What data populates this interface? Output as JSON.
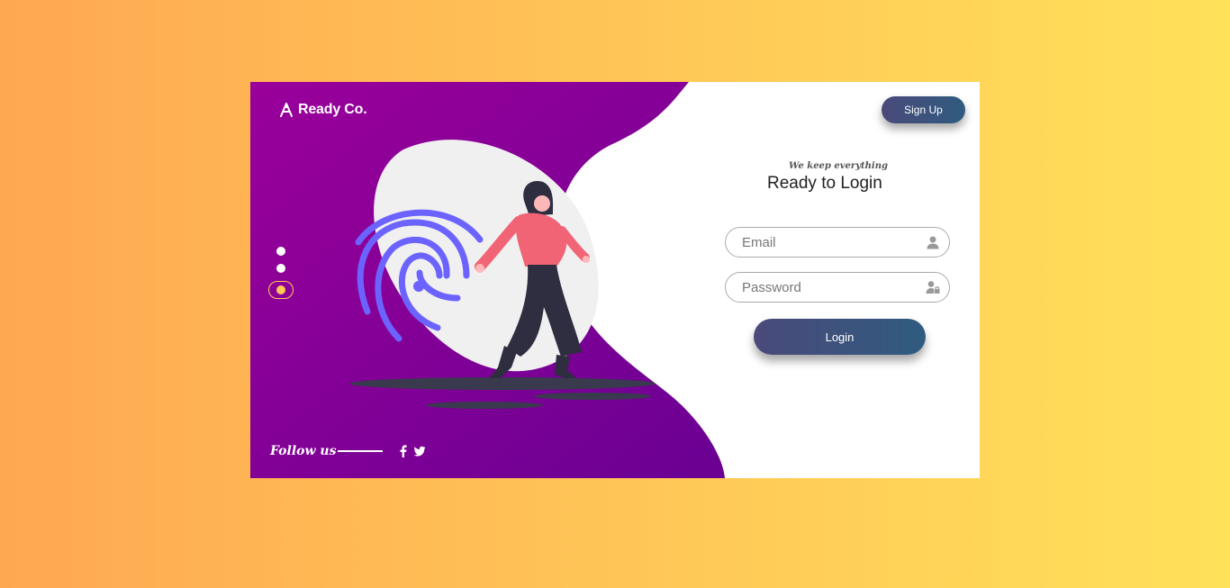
{
  "brand": {
    "name": "Ready Co.",
    "icon": "logo-icon"
  },
  "nav": {
    "signup_label": "Sign Up"
  },
  "hero": {
    "slides_total": 3,
    "active_slide": 3,
    "illustration": "fingerprint-woman-illustration"
  },
  "follow": {
    "label": "Follow us",
    "socials": [
      "facebook-icon",
      "twitter-icon"
    ]
  },
  "login": {
    "tagline": "We keep everything",
    "title": "Ready to Login",
    "email_placeholder": "Email",
    "password_placeholder": "Password",
    "email_icon": "user-icon",
    "password_icon": "user-lock-icon",
    "login_label": "Login"
  },
  "colors": {
    "purple_start": "#980099",
    "purple_end": "#6a0093",
    "accent": "#ffc857",
    "button_start": "#4a4a7a",
    "button_end": "#2f5b7f",
    "fingerprint": "#6c63ff",
    "shirt": "#f06476"
  }
}
